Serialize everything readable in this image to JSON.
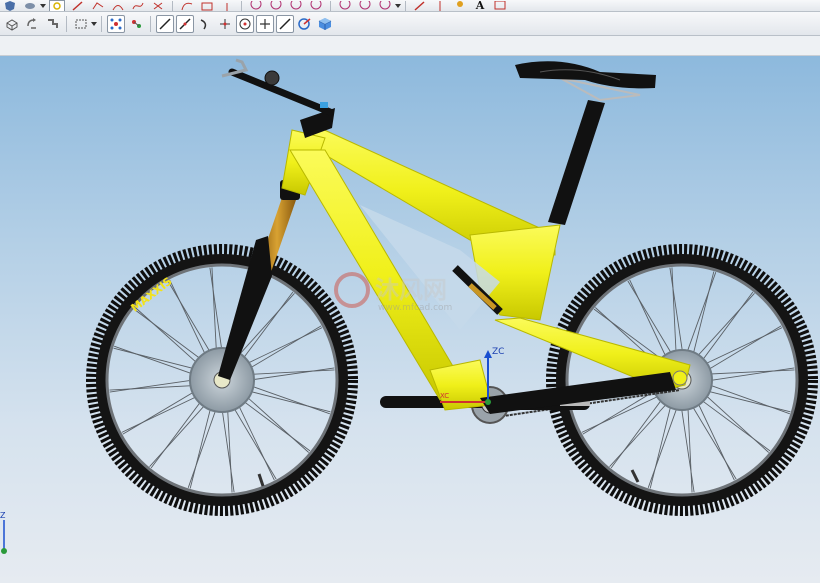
{
  "toolbar_row1": {
    "icons": [
      "shield-icon",
      "layers-icon",
      "cursor-icon",
      "pencil-icon",
      "sketch-icon",
      "arc-icon",
      "spline-icon",
      "cut-icon",
      "circle-icon",
      "circle-icon",
      "circle-icon",
      "circle-icon",
      "circle-icon",
      "circle-icon",
      "arrow-icon",
      "lamp-icon",
      "text-icon",
      "rectangle-icon"
    ],
    "text_tool_label": "A"
  },
  "toolbar_row2": {
    "icons": [
      "wireframe-icon",
      "rotate-icon",
      "pan-icon",
      "select-box-icon",
      "snap-grid-icon",
      "node-icon",
      "line-icon",
      "slash-line-icon",
      "curve-icon",
      "intersection-icon",
      "point-on-curve-icon",
      "plus-point-icon",
      "tangent-icon",
      "view-orient-icon",
      "cube-icon"
    ]
  },
  "viewport": {
    "tire_brand": "MAXXIS",
    "watermark_brand": "沐风网",
    "watermark_url": "www.mfcad.com",
    "wcs_axis_label": "ZC",
    "wcs_x_label": "XC",
    "corner_axis_label": "Z",
    "colors": {
      "frame": "#f2f21a",
      "fork_stanchion": "#c89624",
      "tire": "#0e0e0e",
      "background_top": "#8db9dd",
      "background_bottom": "#e6ebf1"
    }
  }
}
